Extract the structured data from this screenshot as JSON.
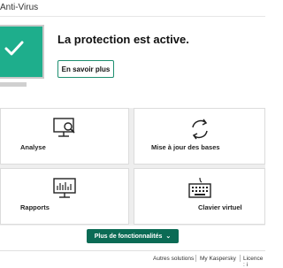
{
  "window": {
    "title": "Anti-Virus"
  },
  "status": {
    "heading": "La protection est active.",
    "learn_more": "En savoir plus",
    "state_color": "#1eae8c",
    "icon": "checkmark-icon"
  },
  "tiles": [
    {
      "label": "Analyse",
      "icon": "monitor-scan-icon"
    },
    {
      "label": "Mise à jour des bases",
      "icon": "refresh-icon"
    },
    {
      "label": "Rapports",
      "icon": "reports-icon"
    },
    {
      "label": "Clavier virtuel",
      "icon": "keyboard-icon"
    }
  ],
  "more_button": {
    "label": "Plus de fonctionnalités",
    "icon": "chevron-down-icon",
    "color": "#0b6b55"
  },
  "footer": {
    "links": [
      "Autres solutions",
      "My Kaspersky",
      "Licence : i"
    ]
  }
}
